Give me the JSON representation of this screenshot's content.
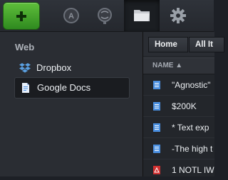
{
  "sidebar": {
    "section_title": "Web",
    "items": [
      {
        "label": "Dropbox",
        "icon": "dropbox-icon"
      },
      {
        "label": "Google Docs",
        "icon": "google-docs-icon"
      }
    ]
  },
  "breadcrumb": {
    "home": "Home",
    "current": "All It"
  },
  "file_list": {
    "column_name": "NAME ▲",
    "rows": [
      {
        "name": "\"Agnostic\"",
        "type": "document"
      },
      {
        "name": "$200K",
        "type": "document"
      },
      {
        "name": "* Text exp",
        "type": "document"
      },
      {
        "name": "-The high t",
        "type": "document"
      },
      {
        "name": "1 NOTL IW",
        "type": "pdf"
      }
    ]
  },
  "colors": {
    "accent_green": "#4caf2f",
    "doc_icon_blue": "#4a8fe0",
    "pdf_icon_red": "#d03030"
  }
}
